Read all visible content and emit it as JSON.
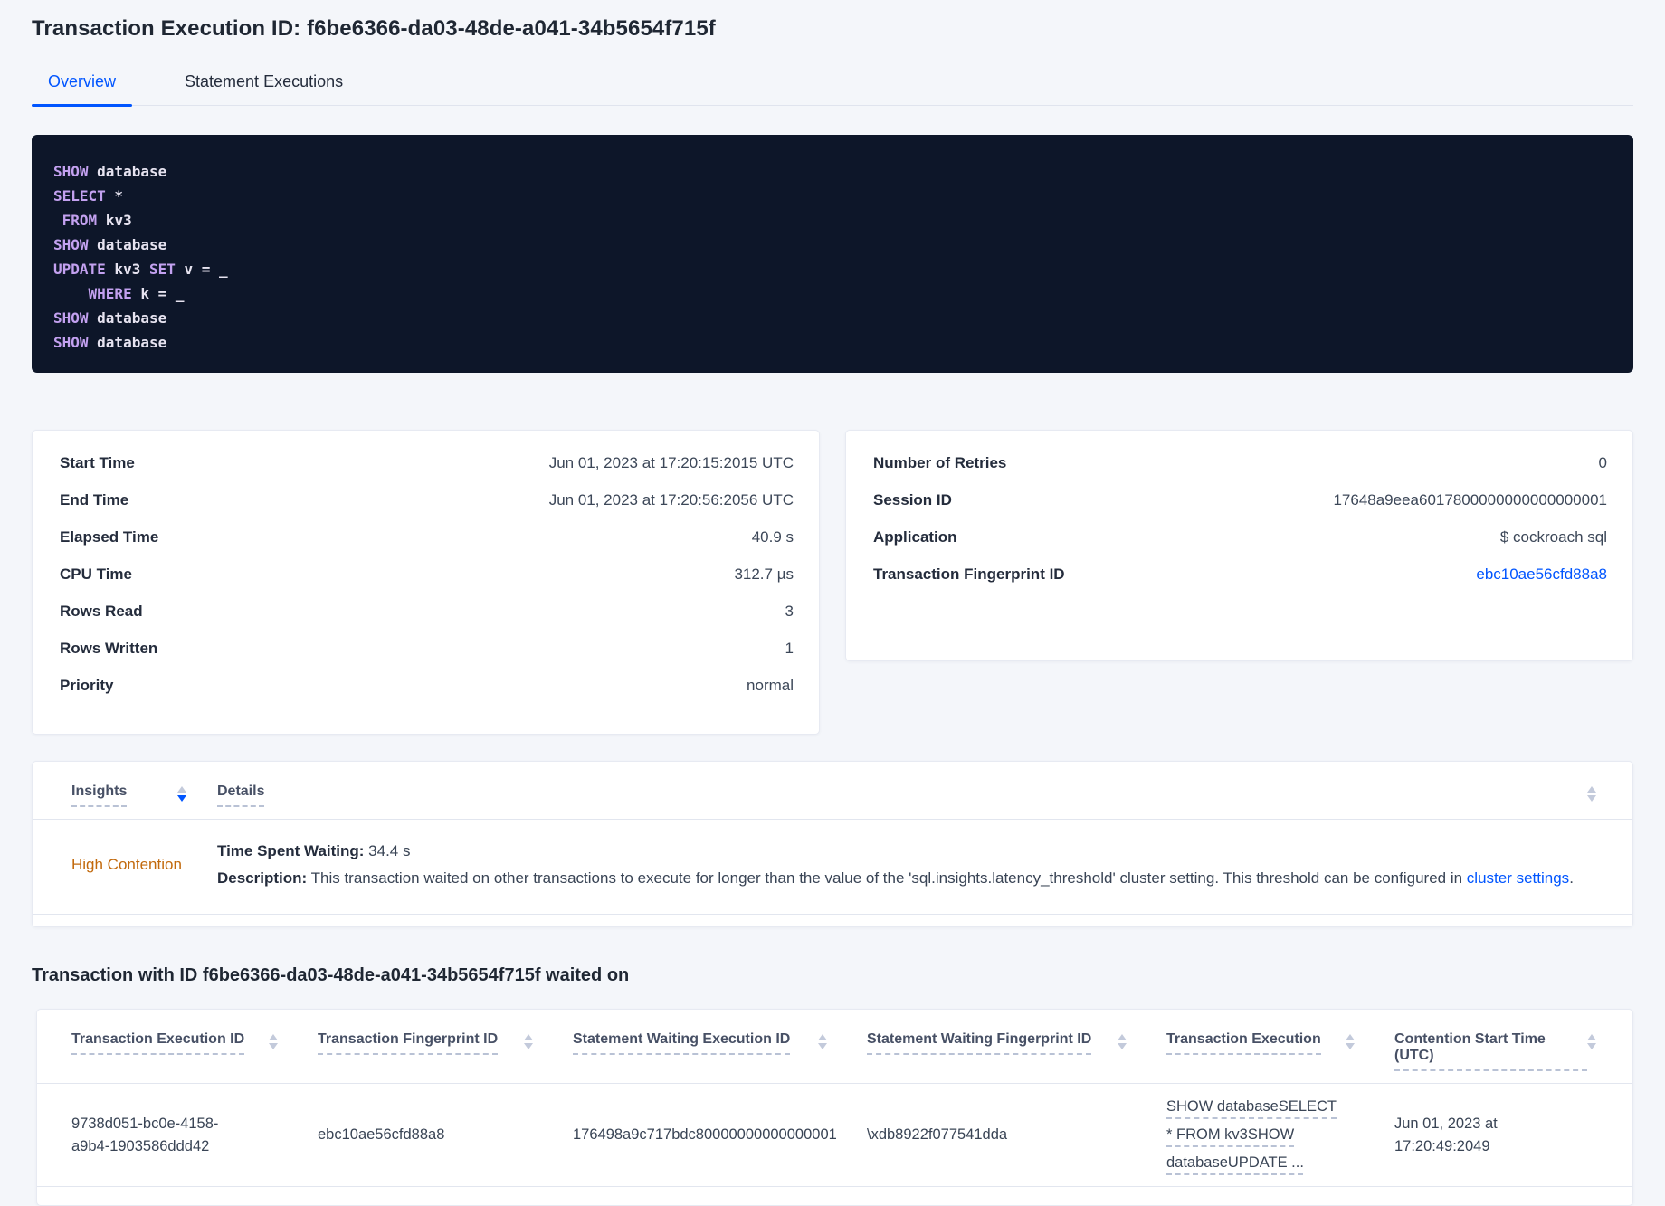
{
  "header": {
    "title": "Transaction Execution ID: f6be6366-da03-48de-a041-34b5654f715f",
    "tabs": [
      {
        "label": "Overview"
      },
      {
        "label": "Statement Executions"
      }
    ]
  },
  "sql": {
    "lines": [
      {
        "tokens": [
          {
            "t": "SHOW"
          },
          {
            "t": " database"
          }
        ]
      },
      {
        "tokens": [
          {
            "t": "SELECT"
          },
          {
            "t": " *"
          }
        ]
      },
      {
        "tokens": [
          {
            "t": " FROM"
          },
          {
            "t": " kv3"
          }
        ]
      },
      {
        "tokens": [
          {
            "t": "SHOW"
          },
          {
            "t": " database"
          }
        ]
      },
      {
        "tokens": [
          {
            "t": "UPDATE"
          },
          {
            "t": " kv3"
          },
          {
            "t": " SET"
          },
          {
            "t": " v = _"
          }
        ]
      },
      {
        "tokens": [
          {
            "t": "    WHERE"
          },
          {
            "t": " k = _"
          }
        ]
      },
      {
        "tokens": [
          {
            "t": "SHOW"
          },
          {
            "t": " database"
          }
        ]
      },
      {
        "tokens": [
          {
            "t": "SHOW"
          },
          {
            "t": " database"
          }
        ]
      }
    ]
  },
  "summary_left": {
    "rows": [
      {
        "label": "Start Time",
        "value": "Jun 01, 2023 at 17:20:15:2015 UTC"
      },
      {
        "label": "End Time",
        "value": "Jun 01, 2023 at 17:20:56:2056 UTC"
      },
      {
        "label": "Elapsed Time",
        "value": "40.9 s"
      },
      {
        "label": "CPU Time",
        "value": "312.7 µs"
      },
      {
        "label": "Rows Read",
        "value": "3"
      },
      {
        "label": "Rows Written",
        "value": "1"
      },
      {
        "label": "Priority",
        "value": "normal"
      }
    ]
  },
  "summary_right": {
    "rows": [
      {
        "label": "Number of Retries",
        "value": "0"
      },
      {
        "label": "Session ID",
        "value": "17648a9eea6017800000000000000001"
      },
      {
        "label": "Application",
        "value": "$ cockroach sql"
      },
      {
        "label": "Transaction Fingerprint ID",
        "value": "ebc10ae56cfd88a8"
      }
    ]
  },
  "insights": {
    "columns": {
      "insights": "Insights",
      "details": "Details"
    },
    "row": {
      "insight": "High Contention",
      "waiting_label": "Time Spent Waiting:",
      "waiting_value": " 34.4 s",
      "description_label": "Description:",
      "description_text": " This transaction waited on other transactions to execute for longer than the value of the 'sql.insights.latency_threshold' cluster setting. This threshold can be configured in ",
      "description_link": "cluster settings",
      "description_period": "."
    }
  },
  "waited_section": {
    "heading": "Transaction with ID f6be6366-da03-48de-a041-34b5654f715f waited on",
    "columns": [
      "Transaction Execution ID",
      "Transaction Fingerprint ID",
      "Statement Waiting Execution ID",
      "Statement Waiting Fingerprint ID",
      "Transaction Execution",
      "Contention Start Time (UTC)"
    ],
    "row": {
      "transaction_execution_id": "9738d051-bc0e-4158-a9b4-1903586ddd42",
      "transaction_fingerprint_id": "ebc10ae56cfd88a8",
      "statement_waiting_execution_id": "176498a9c717bdc80000000000000001",
      "statement_waiting_fingerprint_id": "\\xdb8922f077541dda",
      "transaction_execution": "SHOW databaseSELECT * FROM kv3SHOW databaseUPDATE ...",
      "contention_start_time": "Jun 01, 2023 at 17:20:49:2049"
    }
  },
  "colors": {
    "accent_blue": "#0055ff",
    "insight_orange": "#c2690c",
    "code_background": "#0d1629",
    "code_keyword": "#c3a1f0"
  }
}
